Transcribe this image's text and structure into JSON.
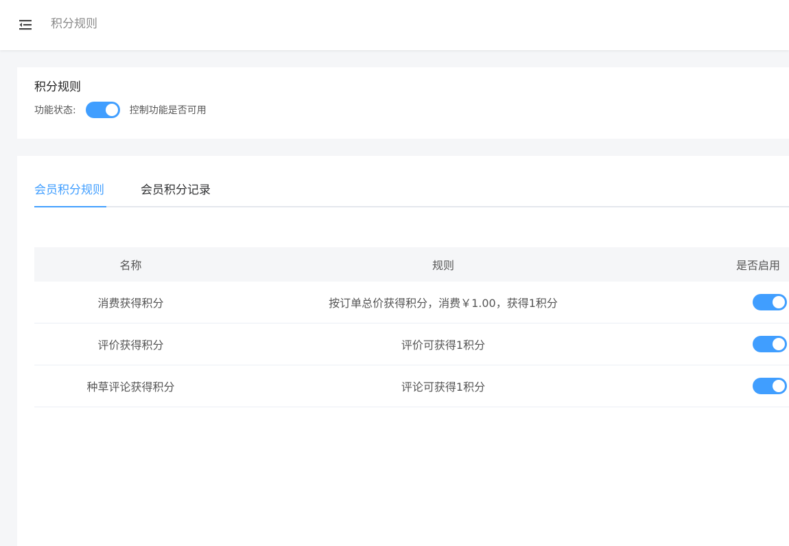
{
  "header": {
    "title": "积分规则"
  },
  "status_card": {
    "title": "积分规则",
    "label": "功能状态:",
    "enabled": true,
    "description": "控制功能是否可用"
  },
  "tabs": [
    {
      "label": "会员积分规则",
      "active": true
    },
    {
      "label": "会员积分记录",
      "active": false
    }
  ],
  "table": {
    "columns": [
      "名称",
      "规则",
      "是否启用"
    ],
    "rows": [
      {
        "name": "消费获得积分",
        "rule": "按订单总价获得积分，消费￥1.00，获得1积分",
        "enabled": true
      },
      {
        "name": "评价获得积分",
        "rule": "评价可获得1积分",
        "enabled": true
      },
      {
        "name": "种草评论获得积分",
        "rule": "评论可获得1积分",
        "enabled": true
      }
    ]
  },
  "colors": {
    "accent": "#409eff",
    "page_bg": "#f5f6f8",
    "header_row_bg": "#f5f6f8"
  },
  "icons": {
    "menu_toggle": "menu-fold-icon"
  }
}
